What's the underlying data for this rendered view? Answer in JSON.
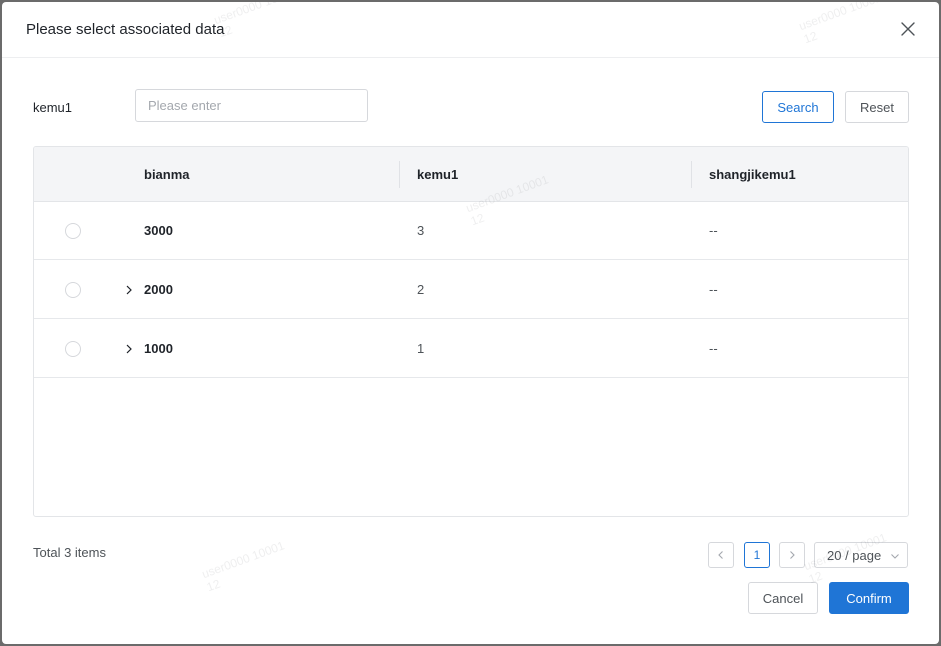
{
  "dialog": {
    "title": "Please select associated data",
    "close_icon": "close-icon"
  },
  "filter": {
    "label": "kemu1",
    "placeholder": "Please enter",
    "value": "",
    "search_label": "Search",
    "reset_label": "Reset"
  },
  "table": {
    "columns": [
      "bianma",
      "kemu1",
      "shangjikemu1"
    ],
    "rows": [
      {
        "bianma": "3000",
        "kemu1": "3",
        "shangjikemu1": "--",
        "expandable": false,
        "selected": false
      },
      {
        "bianma": "2000",
        "kemu1": "2",
        "shangjikemu1": "--",
        "expandable": true,
        "selected": false
      },
      {
        "bianma": "1000",
        "kemu1": "1",
        "shangjikemu1": "--",
        "expandable": true,
        "selected": false
      }
    ]
  },
  "pagination": {
    "total_text": "Total 3 items",
    "current_page": "1",
    "page_size": "20 / page"
  },
  "footer": {
    "cancel_label": "Cancel",
    "confirm_label": "Confirm"
  },
  "watermark": {
    "line1": "user0000 10001",
    "line2": "12"
  },
  "colors": {
    "primary": "#1f75d6",
    "border": "#d6d8dc",
    "header_bg": "#f4f5f7"
  }
}
